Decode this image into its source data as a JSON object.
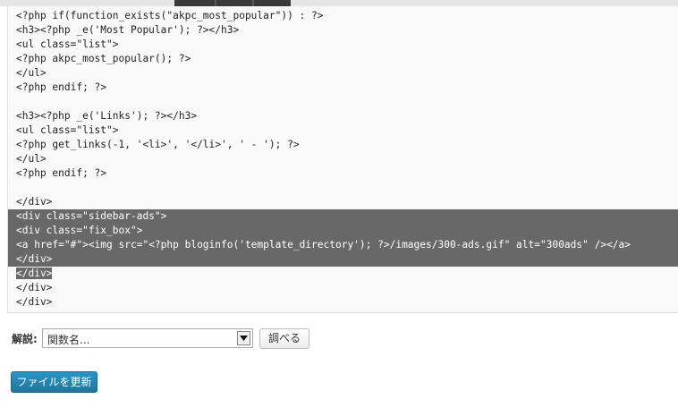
{
  "code_lines": [
    "<?php if(function_exists(\"akpc_most_popular\")) : ?>",
    "<h3><?php _e('Most Popular'); ?></h3>",
    "<ul class=\"list\">",
    "<?php akpc_most_popular(); ?>",
    "</ul>",
    "<?php endif; ?>",
    "",
    "<h3><?php _e('Links'); ?></h3>",
    "<ul class=\"list\">",
    "<?php get_links(-1, '<li>', '</li>', ' - '); ?>",
    "</ul>",
    "<?php endif; ?>",
    "",
    "</div>",
    "<div class=\"sidebar-ads\">",
    "<div class=\"fix_box\">",
    "<a href=\"#\"><img src=\"<?php bloginfo('template_directory'); ?>/images/300-ads.gif\" alt=\"300ads\" /></a>",
    "</div>",
    "</div>",
    "</div>",
    "</div>"
  ],
  "selection": {
    "first_full_line": 14,
    "last_full_line": 17,
    "partial_line": 18
  },
  "doc_lookup": {
    "label": "解説:",
    "select_value": "関数名...",
    "button_label": "調べる"
  },
  "update_button_label": "ファイルを更新",
  "colors": {
    "selection_bg": "#686868",
    "editor_bg": "#f9f9f9",
    "primary_button": "#21759b"
  }
}
